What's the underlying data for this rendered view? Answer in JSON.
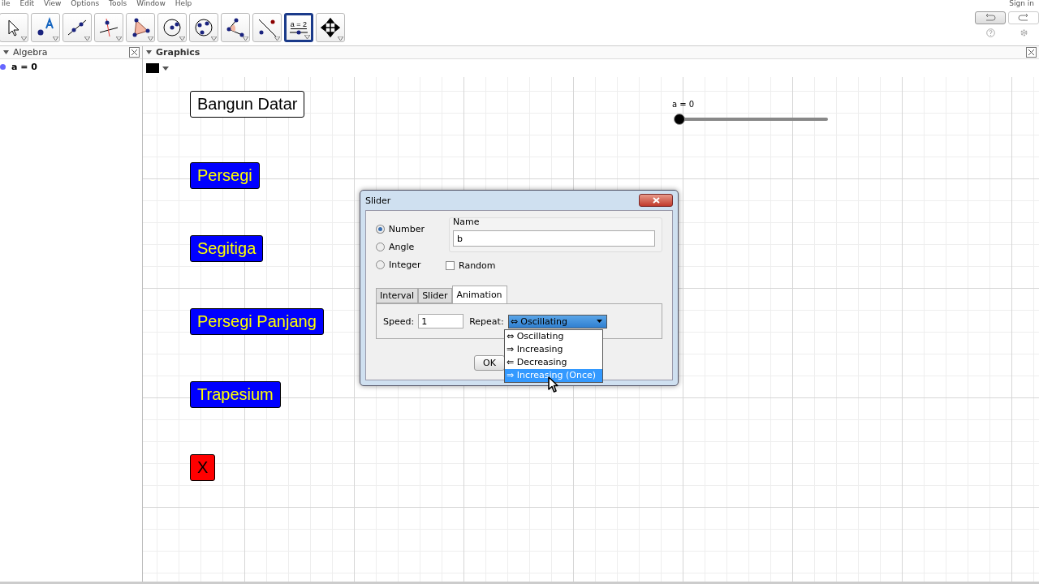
{
  "menu": [
    "ile",
    "Edit",
    "View",
    "Options",
    "Tools",
    "Window",
    "Help"
  ],
  "sign_in": "Sign in",
  "toolbar": {
    "tools": [
      {
        "kind": "move",
        "selected": false
      },
      {
        "kind": "point",
        "selected": false
      },
      {
        "kind": "line",
        "selected": false
      },
      {
        "kind": "perpendicular",
        "selected": false
      },
      {
        "kind": "polygon",
        "selected": false
      },
      {
        "kind": "circle",
        "selected": false
      },
      {
        "kind": "circle3",
        "selected": false
      },
      {
        "kind": "angle",
        "selected": false
      },
      {
        "kind": "reflect",
        "selected": false
      },
      {
        "kind": "slider",
        "selected": true,
        "label": "a = 2"
      },
      {
        "kind": "pan",
        "selected": false
      }
    ]
  },
  "algebra": {
    "title": "Algebra",
    "items": [
      {
        "text": "a = 0",
        "color": "#6666ff"
      }
    ]
  },
  "graphics": {
    "title": "Graphics",
    "buttons": [
      {
        "label": "Bangun Datar",
        "color": "#ffffff"
      },
      {
        "label": "Persegi",
        "color": "#0000ff"
      },
      {
        "label": "Segitiga",
        "color": "#0000ff"
      },
      {
        "label": "Persegi Panjang",
        "color": "#0000ff"
      },
      {
        "label": "Trapesium",
        "color": "#0000ff"
      },
      {
        "label": "X",
        "color": "#ff0000"
      }
    ],
    "slider": {
      "label": "a = 0",
      "level": 0
    }
  },
  "dialog": {
    "title": "Slider",
    "types": [
      {
        "label": "Number",
        "selected": true
      },
      {
        "label": "Angle",
        "selected": false
      },
      {
        "label": "Integer",
        "selected": false
      }
    ],
    "name_label": "Name",
    "name_value": "b",
    "random": {
      "label": "Random",
      "checked": false
    },
    "tabs": [
      {
        "label": "Interval",
        "selected": false
      },
      {
        "label": "Slider",
        "selected": false
      },
      {
        "label": "Animation",
        "selected": true
      }
    ],
    "speed_label": "Speed:",
    "speed_value": "1",
    "repeat_label": "Repeat:",
    "repeat_value": "⇔ Oscillating",
    "repeat_options": [
      {
        "label": "⇔ Oscillating",
        "selected": false
      },
      {
        "label": "⇒ Increasing",
        "selected": false
      },
      {
        "label": "⇐ Decreasing",
        "selected": false
      },
      {
        "label": "⇒ Increasing (Once)",
        "selected": true
      }
    ],
    "ok": "OK"
  }
}
